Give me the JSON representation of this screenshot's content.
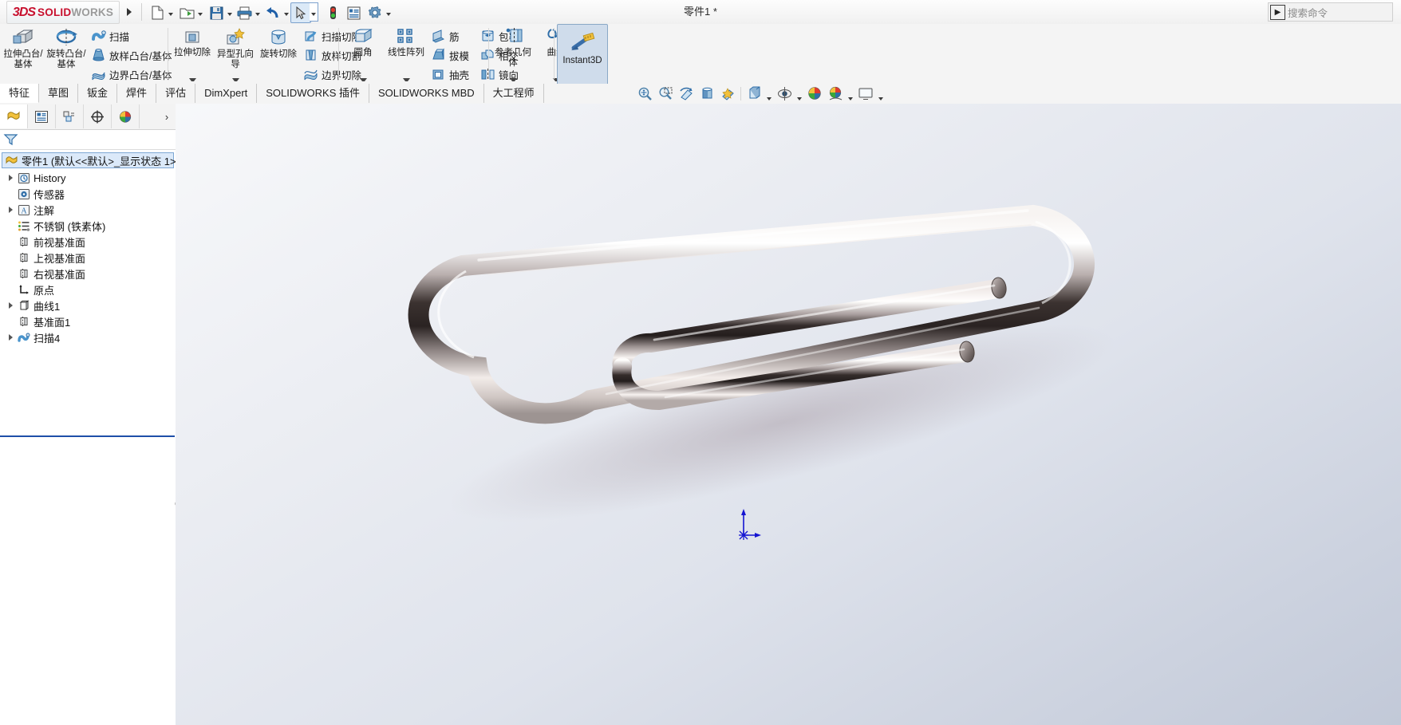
{
  "app": {
    "brand_3ds": "3DS",
    "brand_solid": "SOLID",
    "brand_works": "WORKS",
    "document_title": "零件1 *",
    "accent_blue": "#1f4fa8",
    "brand_red": "#c8102e"
  },
  "search": {
    "placeholder": "搜索命令",
    "icon": "search-icon"
  },
  "quick_access": [
    {
      "name": "new-document",
      "icon": "new-file-icon",
      "has_dropdown": true
    },
    {
      "name": "open-document",
      "icon": "open-folder-icon",
      "has_dropdown": true
    },
    {
      "name": "save-document",
      "icon": "save-disk-icon",
      "has_dropdown": true
    },
    {
      "name": "print-document",
      "icon": "printer-icon",
      "has_dropdown": true
    },
    {
      "name": "undo",
      "icon": "undo-arrow-icon",
      "has_dropdown": true
    },
    {
      "name": "select",
      "icon": "cursor-arrow-icon",
      "has_dropdown": true,
      "selected": true
    },
    {
      "name": "rebuild",
      "icon": "traffic-light-icon",
      "has_dropdown": false
    },
    {
      "name": "file-properties",
      "icon": "properties-icon",
      "has_dropdown": false
    },
    {
      "name": "options",
      "icon": "gear-icon",
      "has_dropdown": true
    }
  ],
  "ribbon": {
    "groups": [
      {
        "name": "boss-base-group",
        "big": [
          {
            "label": "拉伸凸台/基体",
            "icon": "extrude-boss-icon",
            "dropdown": false
          },
          {
            "label": "旋转凸台/基体",
            "icon": "revolve-boss-icon",
            "dropdown": false
          }
        ],
        "small": [
          {
            "label": "扫描",
            "icon": "sweep-icon"
          },
          {
            "label": "放样凸台/基体",
            "icon": "loft-boss-icon"
          },
          {
            "label": "边界凸台/基体",
            "icon": "boundary-boss-icon"
          }
        ]
      },
      {
        "name": "cut-group",
        "big": [
          {
            "label": "拉伸切除",
            "icon": "extrude-cut-icon",
            "dropdown": true
          },
          {
            "label": "异型孔向导",
            "icon": "hole-wizard-icon",
            "dropdown": true
          },
          {
            "label": "旋转切除",
            "icon": "revolve-cut-icon",
            "dropdown": false
          }
        ],
        "small": [
          {
            "label": "扫描切除",
            "icon": "sweep-cut-icon"
          },
          {
            "label": "放样切割",
            "icon": "loft-cut-icon"
          },
          {
            "label": "边界切除",
            "icon": "boundary-cut-icon"
          }
        ]
      },
      {
        "name": "fillet-pattern-group",
        "big": [
          {
            "label": "圆角",
            "icon": "fillet-icon",
            "dropdown": true
          },
          {
            "label": "线性阵列",
            "icon": "linear-pattern-icon",
            "dropdown": true
          }
        ],
        "small": [
          {
            "label": "筋",
            "icon": "rib-icon"
          },
          {
            "label": "拔模",
            "icon": "draft-icon"
          },
          {
            "label": "抽壳",
            "icon": "shell-icon"
          }
        ],
        "small2": [
          {
            "label": "包覆",
            "icon": "wrap-icon"
          },
          {
            "label": "相交",
            "icon": "intersect-icon"
          },
          {
            "label": "镜向",
            "icon": "mirror-icon"
          }
        ]
      },
      {
        "name": "reference-group",
        "big": [
          {
            "label": "参考几何体",
            "icon": "reference-geometry-icon",
            "dropdown": true
          },
          {
            "label": "曲线",
            "icon": "curves-icon",
            "dropdown": true
          }
        ]
      },
      {
        "name": "instant3d-group",
        "big": [
          {
            "label": "Instant3D",
            "icon": "instant3d-icon",
            "dropdown": false,
            "active": true
          }
        ]
      }
    ]
  },
  "tabs": [
    {
      "label": "特征",
      "active": true
    },
    {
      "label": "草图",
      "active": false
    },
    {
      "label": "钣金",
      "active": false
    },
    {
      "label": "焊件",
      "active": false
    },
    {
      "label": "评估",
      "active": false
    },
    {
      "label": "DimXpert",
      "active": false
    },
    {
      "label": "SOLIDWORKS 插件",
      "active": false
    },
    {
      "label": "SOLIDWORKS MBD",
      "active": false
    },
    {
      "label": "大工程师",
      "active": false
    }
  ],
  "feature_manager": {
    "panel_tabs": [
      {
        "name": "feature-tree-tab",
        "icon": "feature-tree-icon",
        "active": true
      },
      {
        "name": "property-manager-tab",
        "icon": "property-manager-icon",
        "active": false
      },
      {
        "name": "configuration-manager-tab",
        "icon": "configuration-manager-icon",
        "active": false
      },
      {
        "name": "dimxpert-manager-tab",
        "icon": "dimxpert-manager-icon",
        "active": false
      },
      {
        "name": "display-manager-tab",
        "icon": "display-manager-icon",
        "active": false
      }
    ],
    "expand_arrow": "›",
    "filter_icon": "filter-funnel-icon",
    "tree": [
      {
        "label": "零件1  (默认<<默认>_显示状态 1>)",
        "icon": "part-icon",
        "twist": false,
        "root": true,
        "indent": 0
      },
      {
        "label": "History",
        "icon": "history-icon",
        "twist": true,
        "indent": 1
      },
      {
        "label": "传感器",
        "icon": "sensors-icon",
        "twist": false,
        "indent": 1
      },
      {
        "label": "注解",
        "icon": "annotations-icon",
        "twist": true,
        "indent": 1
      },
      {
        "label": "不锈钢 (铁素体)",
        "icon": "material-icon",
        "twist": false,
        "indent": 1
      },
      {
        "label": "前视基准面",
        "icon": "plane-icon",
        "twist": false,
        "indent": 1
      },
      {
        "label": "上视基准面",
        "icon": "plane-icon",
        "twist": false,
        "indent": 1
      },
      {
        "label": "右视基准面",
        "icon": "plane-icon",
        "twist": false,
        "indent": 1
      },
      {
        "label": "原点",
        "icon": "origin-icon",
        "twist": false,
        "indent": 1
      },
      {
        "label": "曲线1",
        "icon": "curve-feature-icon",
        "twist": true,
        "indent": 1
      },
      {
        "label": "基准面1",
        "icon": "plane-icon",
        "twist": false,
        "indent": 1
      },
      {
        "label": "扫描4",
        "icon": "sweep-feature-icon",
        "twist": true,
        "indent": 1
      }
    ]
  },
  "view_toolbar": [
    {
      "name": "zoom-to-fit-button",
      "icon": "zoom-to-fit-icon",
      "dropdown": false
    },
    {
      "name": "zoom-to-area-button",
      "icon": "zoom-to-area-icon",
      "dropdown": false
    },
    {
      "name": "rotate-view-button",
      "icon": "rotate-view-icon",
      "dropdown": false
    },
    {
      "name": "section-view-button",
      "icon": "section-view-icon",
      "dropdown": false
    },
    {
      "name": "view-orientation-button",
      "icon": "view-orientation-icon",
      "dropdown": false
    },
    {
      "name": "display-style-button",
      "icon": "display-style-icon",
      "dropdown": true
    },
    {
      "name": "hide-show-items-button",
      "icon": "hide-show-icon",
      "dropdown": true
    },
    {
      "name": "edit-appearance-button",
      "icon": "appearance-icon",
      "dropdown": true
    },
    {
      "name": "apply-scene-button",
      "icon": "scene-icon",
      "dropdown": true
    },
    {
      "name": "view-settings-button",
      "icon": "monitor-icon",
      "dropdown": true
    }
  ],
  "model": {
    "name": "paperclip-model",
    "description": "chrome paperclip swept solid",
    "triad_name": "origin-triad"
  }
}
